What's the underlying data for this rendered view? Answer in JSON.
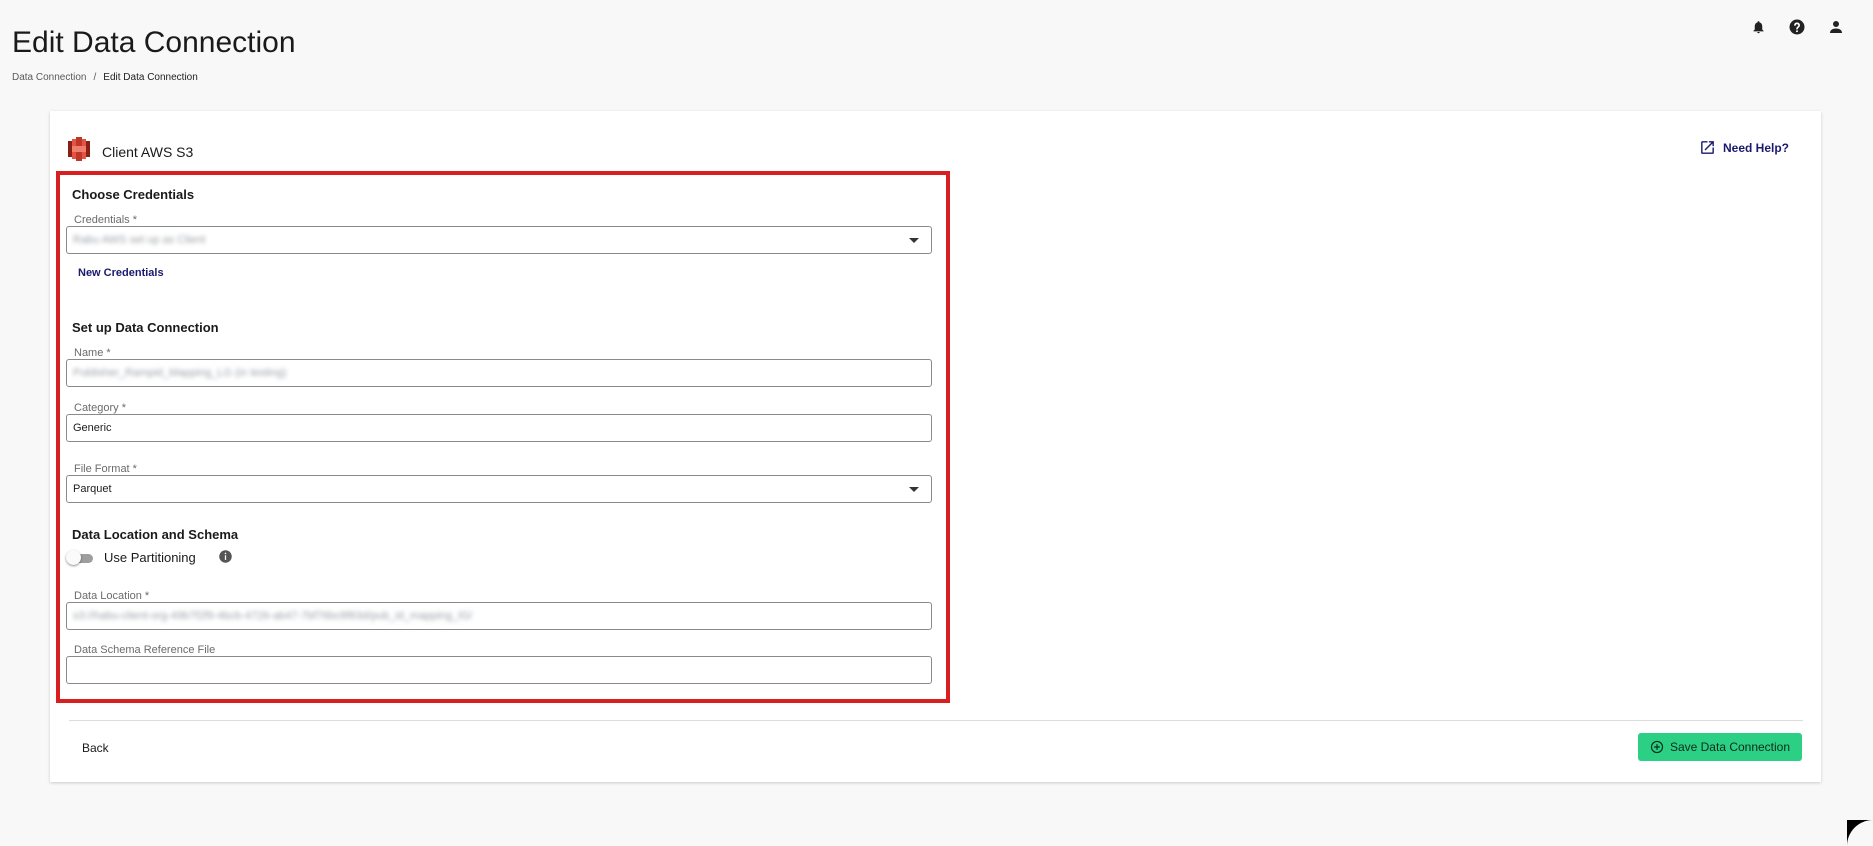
{
  "page": {
    "title": "Edit Data Connection",
    "breadcrumb": {
      "root": "Data Connection",
      "separator": "/",
      "current": "Edit Data Connection"
    }
  },
  "header_icons": [
    "bell-icon",
    "help-icon",
    "user-icon"
  ],
  "card": {
    "connector_name": "Client AWS S3",
    "need_help": "Need Help?",
    "credentials": {
      "section_title": "Choose Credentials",
      "label": "Credentials *",
      "value": "Rabu AWS set up as Client",
      "new_credentials": "New Credentials"
    },
    "setup": {
      "section_title": "Set up Data Connection",
      "name_label": "Name *",
      "name_value": "Publisher_Rampid_Mapping_LG (in testing)",
      "category_label": "Category *",
      "category_value": "Generic",
      "format_label": "File Format *",
      "format_value": "Parquet"
    },
    "location": {
      "section_title": "Data Location and Schema",
      "partitioning_label": "Use Partitioning",
      "partitioning_enabled": false,
      "location_label": "Data Location *",
      "location_value": "s3://habu-client-org-49b7f2f9-4bcb-4726-ab47-7bf76bc8f83d/pub_id_mapping_lG/",
      "schema_label": "Data Schema Reference File",
      "schema_value": ""
    },
    "footer": {
      "back": "Back",
      "save": "Save Data Connection"
    }
  },
  "colors": {
    "accent_link": "#1a1a6e",
    "highlight_border": "#d81e1e",
    "save_button": "#2bd085"
  }
}
